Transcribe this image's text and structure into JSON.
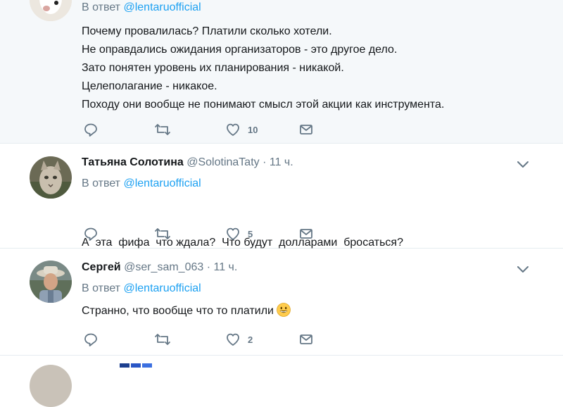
{
  "tweets": [
    {
      "reply_prefix": "В ответ",
      "reply_handle": "@lentaruofficial",
      "lines": [
        "Почему провалилась? Платили сколько хотели.",
        "Не оправдались ожидания организаторов - это другое дело.",
        "Зато понятен уровень их планирования - никакой.",
        "Целеполагание - никакое.",
        "Походу они вообще не понимают смысл этой акции как инструмента."
      ],
      "likes": "10"
    },
    {
      "name": "Татьяна Солотина",
      "handle": "@SolotinaTaty",
      "separator": "·",
      "time": "11 ч.",
      "reply_prefix": "В ответ",
      "reply_handle": "@lentaruofficial",
      "text": "А  эта  фифа  что ждала?  Что будут  долларами  бросаться?",
      "likes": "5"
    },
    {
      "name": "Сергей",
      "handle": "@ser_sam_063",
      "separator": "·",
      "time": "11 ч.",
      "reply_prefix": "В ответ",
      "reply_handle": "@lentaruofficial",
      "text": "Странно, что вообще что то платили",
      "likes": "2"
    }
  ],
  "icons": {
    "reply": "reply-icon",
    "retweet": "retweet-icon",
    "like": "heart-icon",
    "dm": "envelope-icon",
    "more": "chevron-down-icon",
    "emoji": "grinning-face-emoji"
  },
  "colors": {
    "link": "#1da1f2",
    "muted": "#657786",
    "icon": "#657786",
    "highlight_bg": "#f5f8fa",
    "divider": "#e6ecf0"
  }
}
